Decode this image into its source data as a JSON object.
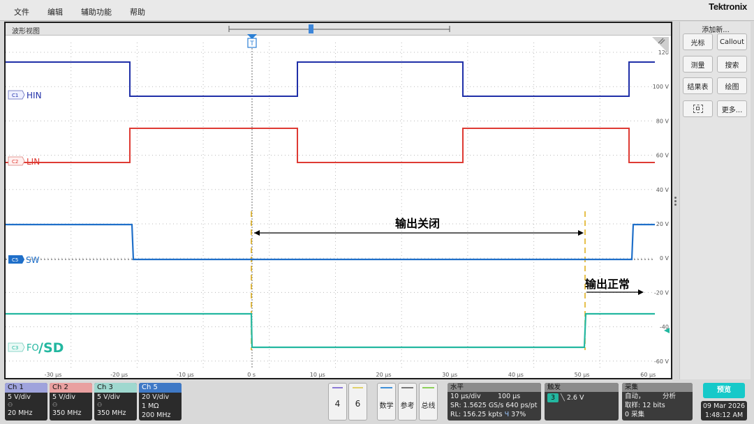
{
  "menu": {
    "file": "文件",
    "edit": "编辑",
    "utility": "辅助功能",
    "help": "帮助"
  },
  "brand": "Tektronix",
  "view_title": "波形视图",
  "trigger_marker": "T",
  "scale_labels": [
    "120",
    "100 V",
    "80 V",
    "60 V",
    "40 V",
    "20 V",
    "0 V",
    "-20 V",
    "-40",
    "-60 V"
  ],
  "time_labels": [
    "-30 µs",
    "-20 µs",
    "-10 µs",
    "0 s",
    "10 µs",
    "20 µs",
    "30 µs",
    "40 µs",
    "50 µs",
    "60 µs"
  ],
  "channels": [
    {
      "tag": "C1",
      "name": "HIN",
      "color": "#1f2fa8"
    },
    {
      "tag": "C2",
      "name": "LIN",
      "color": "#de3a33"
    },
    {
      "tag": "C5",
      "name": "SW",
      "color": "#1f6fc9"
    },
    {
      "tag": "C3",
      "name": "FO",
      "color": "#23b7a0"
    }
  ],
  "annotations": {
    "output_off": "输出关闭",
    "output_normal": "输出正常",
    "sd_label": "/SD"
  },
  "right_panel": {
    "title": "添加新...",
    "cursor": "光标",
    "callout": "Callout",
    "measure": "测量",
    "search": "搜索",
    "results": "结果表",
    "plot": "绘图",
    "more": "更多..."
  },
  "channel_boxes": [
    {
      "title": "Ch 1",
      "scale": "5 V/div",
      "bw": "20 MHz",
      "color": "#9fa3dc"
    },
    {
      "title": "Ch 2",
      "scale": "5 V/div",
      "bw": "350 MHz",
      "color": "#e9a0a0"
    },
    {
      "title": "Ch 3",
      "scale": "5 V/div",
      "bw": "350 MHz",
      "color": "#9fd8cf"
    },
    {
      "title": "Ch 5",
      "scale": "20 V/div",
      "imp": "1 MΩ",
      "bw": "200 MHz",
      "color": "#3f79c6"
    }
  ],
  "num_buttons": [
    "4",
    "6"
  ],
  "tool_buttons": {
    "math": "数学",
    "ref": "参考",
    "bus": "总线"
  },
  "horizontal": {
    "title": "水平",
    "scale": "10 µs/div",
    "pos": "100 µs",
    "sr": "SR: 1.5625 GS/s 640 ps/pt",
    "rl": "RL: 156.25 kpts",
    "pct": "37%"
  },
  "trigger": {
    "title": "触发",
    "source": "3",
    "level": "2.6 V"
  },
  "acquire": {
    "title": "采集",
    "mode": "自动，",
    "analyze": "分析",
    "sample": "取样: 12 bits",
    "count": "0 采集"
  },
  "run_label": "预览",
  "date": "09 Mar 2026",
  "time": "1:48:12 AM"
}
